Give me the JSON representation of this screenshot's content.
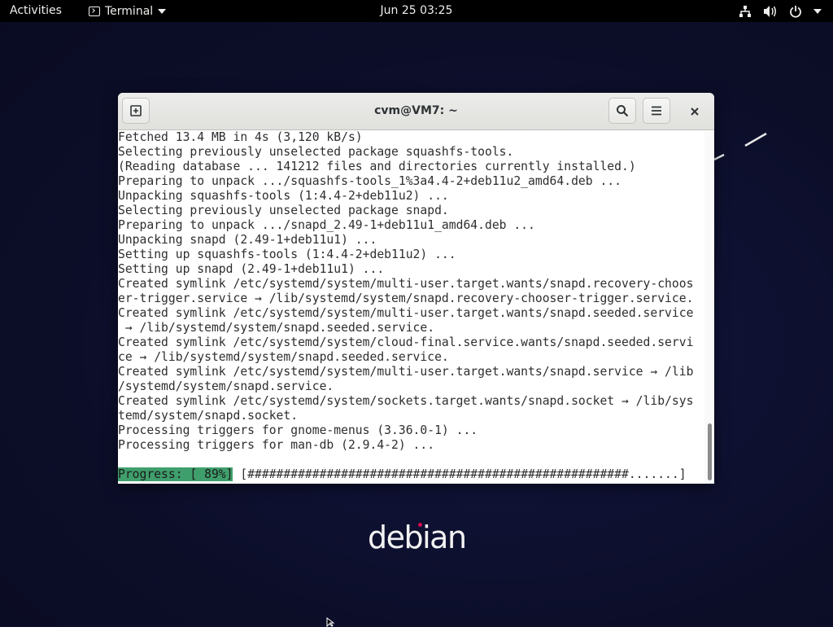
{
  "topbar": {
    "activities": "Activities",
    "app_name": "Terminal",
    "datetime": "Jun 25  03:25",
    "icons": [
      "network-icon",
      "volume-icon",
      "power-icon",
      "system-menu-caret-icon"
    ]
  },
  "window": {
    "title": "cvm@VM7: ~",
    "buttons": [
      "new-tab-icon",
      "search-icon",
      "hamburger-menu-icon",
      "close-icon"
    ]
  },
  "terminal": {
    "lines": [
      "Fetched 13.4 MB in 4s (3,120 kB/s)",
      "Selecting previously unselected package squashfs-tools.",
      "(Reading database ... 141212 files and directories currently installed.)",
      "Preparing to unpack .../squashfs-tools_1%3a4.4-2+deb11u2_amd64.deb ...",
      "Unpacking squashfs-tools (1:4.4-2+deb11u2) ...",
      "Selecting previously unselected package snapd.",
      "Preparing to unpack .../snapd_2.49-1+deb11u1_amd64.deb ...",
      "Unpacking snapd (2.49-1+deb11u1) ...",
      "Setting up squashfs-tools (1:4.4-2+deb11u2) ...",
      "Setting up snapd (2.49-1+deb11u1) ...",
      "Created symlink /etc/systemd/system/multi-user.target.wants/snapd.recovery-choos",
      "er-trigger.service → /lib/systemd/system/snapd.recovery-chooser-trigger.service.",
      "Created symlink /etc/systemd/system/multi-user.target.wants/snapd.seeded.service",
      " → /lib/systemd/system/snapd.seeded.service.",
      "Created symlink /etc/systemd/system/cloud-final.service.wants/snapd.seeded.servi",
      "ce → /lib/systemd/system/snapd.seeded.service.",
      "Created symlink /etc/systemd/system/multi-user.target.wants/snapd.service → /lib",
      "/systemd/system/snapd.service.",
      "Created symlink /etc/systemd/system/sockets.target.wants/snapd.socket → /lib/sys",
      "temd/system/snapd.socket.",
      "Processing triggers for gnome-menus (3.36.0-1) ...",
      "Processing triggers for man-db (2.9.4-2) ...",
      ""
    ],
    "progress_label": "Progress: [ 89%]",
    "progress_bar": " [#####################################################.......]",
    "progress_percent": 89
  },
  "desktop": {
    "logo_text": "debian",
    "logo_dot_color": "#d70a53"
  },
  "colors": {
    "topbar_bg": "#000000",
    "desktop_bg": "#0d0f2c",
    "progress_highlight": "#3f9f6c"
  }
}
